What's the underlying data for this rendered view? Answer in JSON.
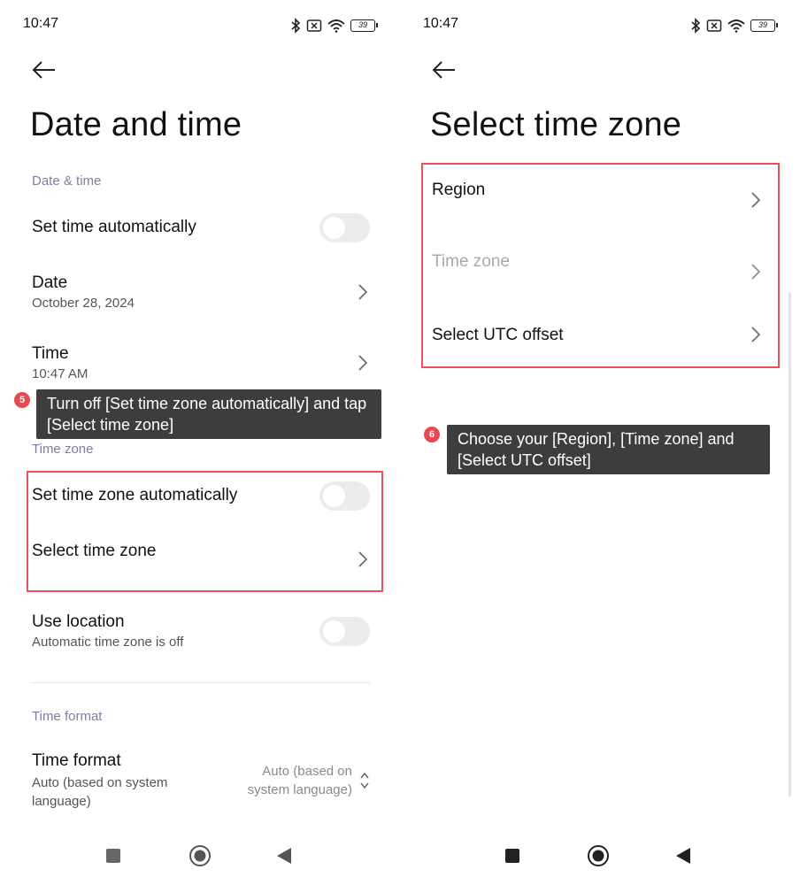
{
  "left": {
    "status": {
      "time": "10:47",
      "battery": "39"
    },
    "title": "Date and time",
    "section_datetime": "Date & time",
    "set_time_auto": "Set time automatically",
    "date": {
      "label": "Date",
      "value": "October 28, 2024"
    },
    "time": {
      "label": "Time",
      "value": "10:47 AM"
    },
    "tooltip": {
      "step": "5",
      "text": "Turn off [Set time zone automatically] and tap [Select time zone]"
    },
    "section_timezone": "Time zone",
    "set_tz_auto": "Set time zone automatically",
    "select_tz": "Select time zone",
    "use_location": {
      "label": "Use location",
      "sub": "Automatic time zone is off"
    },
    "section_format": "Time format",
    "time_format": {
      "label": "Time format",
      "sub": "Auto (based on system language)",
      "value": "Auto (based on system language)"
    }
  },
  "right": {
    "status": {
      "time": "10:47",
      "battery": "39"
    },
    "title": "Select time zone",
    "region": "Region",
    "time_zone": "Time zone",
    "utc_offset": "Select UTC offset",
    "tooltip": {
      "step": "6",
      "text": "Choose your [Region], [Time zone] and [Select UTC offset]"
    }
  },
  "colors": {
    "highlight": "#e8535c",
    "tooltip_bg": "#3d3d3d",
    "section": "#7c7fa1",
    "step_badge": "#e8484f"
  },
  "icons": [
    "bluetooth-icon",
    "no-sim-icon",
    "wifi-icon",
    "battery-icon",
    "back-arrow-icon",
    "chevron-right-icon",
    "chevron-updown-icon",
    "recents-icon",
    "home-icon",
    "back-nav-icon"
  ]
}
